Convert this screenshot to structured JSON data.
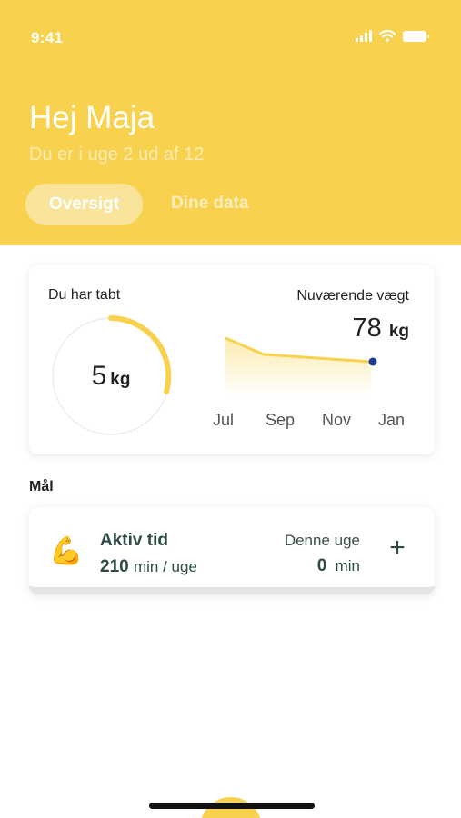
{
  "status_bar": {
    "time": "9:41"
  },
  "header": {
    "greeting": "Hej Maja",
    "subtitle": "Du er i uge 2 ud af 12",
    "tabs": [
      {
        "label": "Oversigt",
        "active": true
      },
      {
        "label": "Dine data",
        "active": false
      }
    ],
    "color": "#F8D24E"
  },
  "weight_card": {
    "lost_label": "Du har tabt",
    "lost_value": "5",
    "lost_unit": "kg",
    "current_label": "Nuværende vægt",
    "current_value": "78",
    "current_unit": "kg",
    "months": [
      "Jul",
      "Sep",
      "Nov",
      "Jan"
    ]
  },
  "goals": {
    "section_label": "Mål",
    "items": [
      {
        "emoji": "💪",
        "title": "Aktiv tid",
        "target_value": "210",
        "target_unit": "min / uge",
        "week_label": "Denne uge",
        "week_value": "0",
        "week_unit": "min",
        "add_symbol": "+"
      }
    ]
  },
  "colors": {
    "accent": "#F8D24E",
    "dark_text": "#2D4B45",
    "point": "#1F3D8A"
  },
  "icons": [
    "signal-icon",
    "wifi-icon",
    "battery-icon",
    "plus-icon",
    "flexed-biceps-icon"
  ]
}
